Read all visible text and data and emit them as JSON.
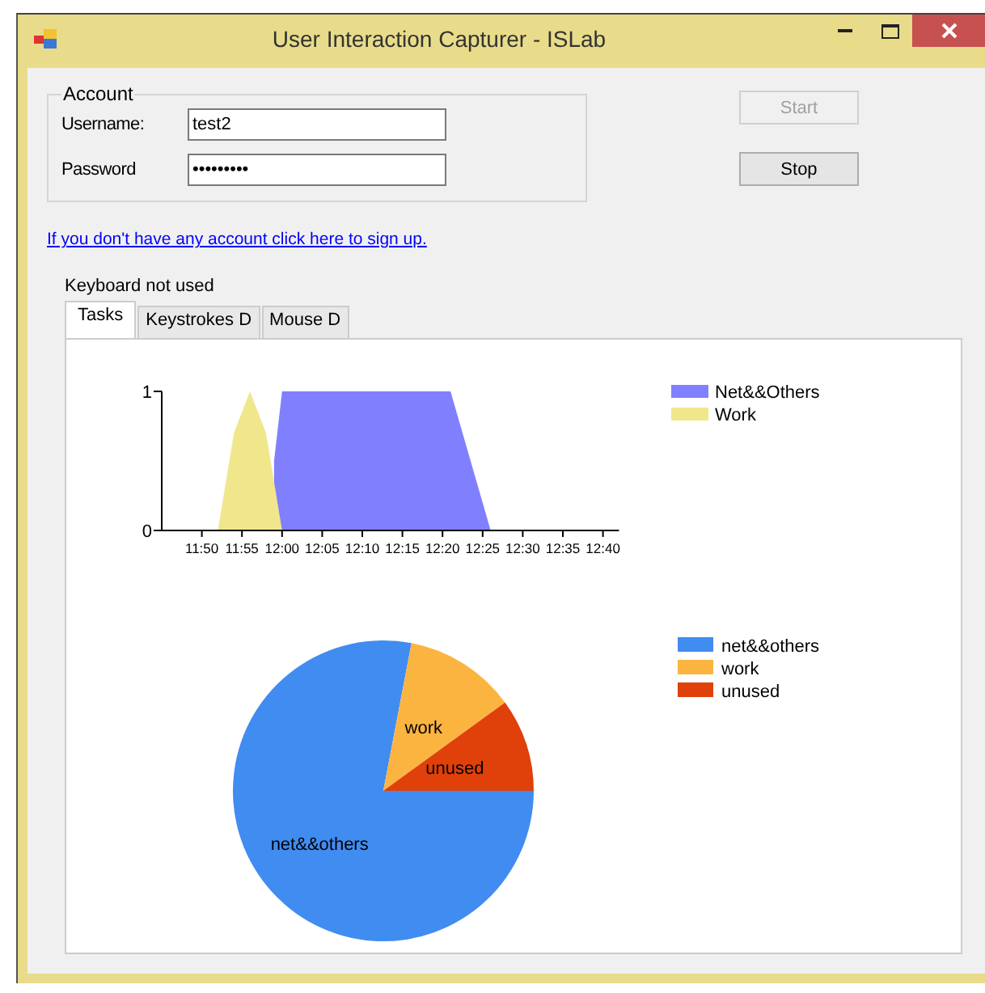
{
  "window": {
    "title": "User Interaction Capturer - ISLab"
  },
  "account": {
    "title": "Account",
    "username_label": "Username:",
    "username": "test2",
    "password_label": "Password",
    "password": "•••••••••"
  },
  "buttons": [
    {
      "label": "Start",
      "disabled": true
    },
    {
      "label": "Stop",
      "disabled": false
    }
  ],
  "signup_link": "If you don't have any account click here to sign up.",
  "status": "Keyboard not used",
  "tabs": [
    {
      "label": "Tasks",
      "selected": true
    },
    {
      "label": "Keystrokes D",
      "selected": false
    },
    {
      "label": "Mouse D",
      "selected": false
    }
  ],
  "tab_panel": {
    "area_chart": {
      "chart_data": {
        "type": "area",
        "x": [
          712,
          714,
          716,
          718,
          719,
          720,
          722,
          741,
          743,
          746
        ],
        "xlim": [
          705,
          762
        ],
        "ylim": [
          0,
          1
        ],
        "legend": "right",
        "yticks": [
          {
            "value": 0,
            "label": "0"
          },
          {
            "value": 1,
            "label": "1"
          }
        ],
        "xticks": [
          {
            "value": 710,
            "label": "11:50"
          },
          {
            "value": 715,
            "label": "11:55"
          },
          {
            "value": 720,
            "label": "12:00"
          },
          {
            "value": 725,
            "label": "12:05"
          },
          {
            "value": 730,
            "label": "12:10"
          },
          {
            "value": 735,
            "label": "12:15"
          },
          {
            "value": 740,
            "label": "12:20"
          },
          {
            "value": 745,
            "label": "12:25"
          },
          {
            "value": 750,
            "label": "12:30"
          },
          {
            "value": 755,
            "label": "12:35"
          },
          {
            "value": 760,
            "label": "12:40"
          }
        ],
        "series": [
          {
            "name": "Net&&Others",
            "color": "#8080ff",
            "values": [
              null,
              null,
              null,
              null,
              0.5,
              1,
              1,
              1,
              0.6,
              0
            ]
          },
          {
            "name": "Work",
            "color": "#f0e68c",
            "values": [
              0,
              0.7,
              1,
              0.7,
              0.35,
              0,
              null,
              null,
              null,
              null
            ]
          }
        ]
      }
    },
    "pie_chart": {
      "chart_data": {
        "type": "pie",
        "categories": [
          "net&&others",
          "work",
          "unused"
        ],
        "values": [
          0.78,
          0.12,
          0.1
        ]
      },
      "legend": [
        {
          "label": "net&&others",
          "color": "#418cf0"
        },
        {
          "label": "work",
          "color": "#fcb441"
        },
        {
          "label": "unused",
          "color": "#e0400a"
        }
      ]
    }
  }
}
